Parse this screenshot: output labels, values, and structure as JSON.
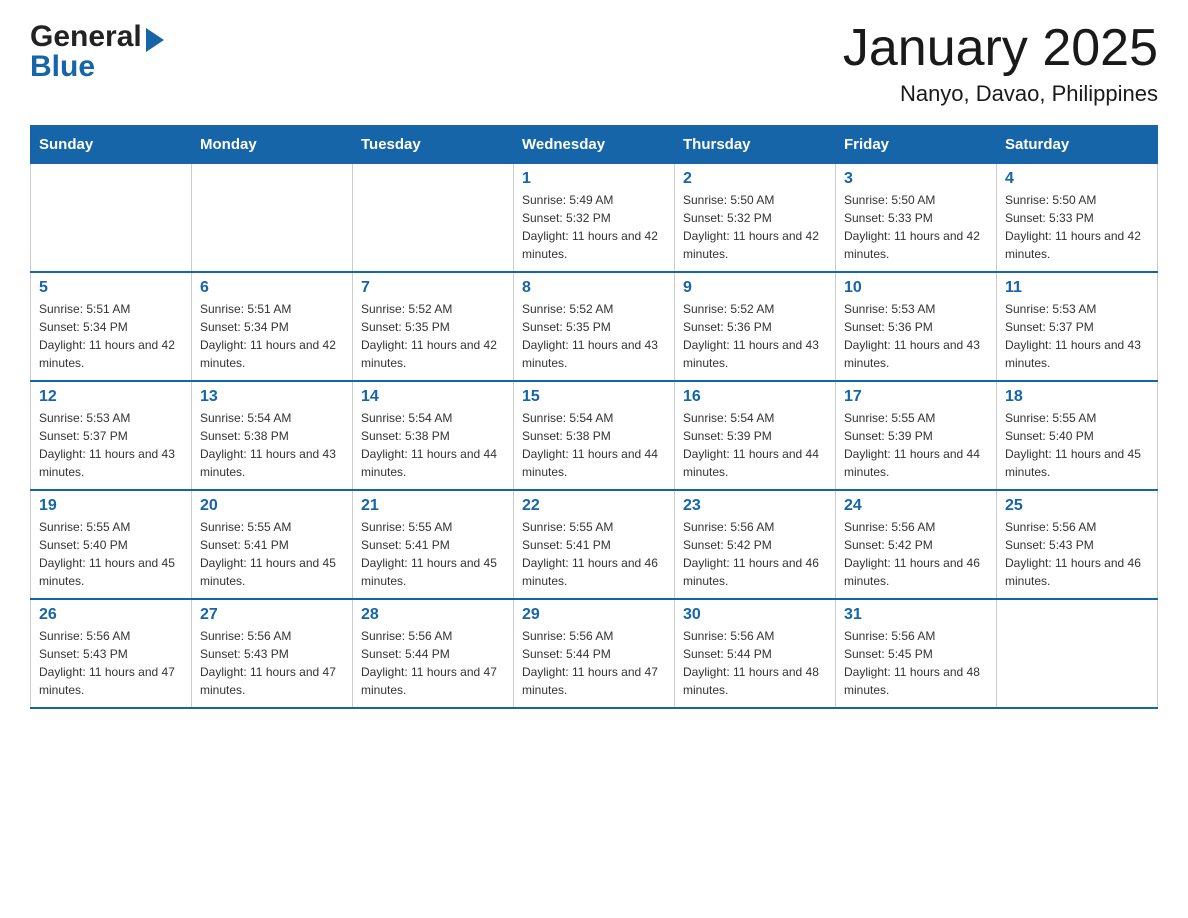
{
  "logo": {
    "general": "General",
    "blue": "Blue",
    "arrow": "▶"
  },
  "title": "January 2025",
  "subtitle": "Nanyo, Davao, Philippines",
  "days_of_week": [
    "Sunday",
    "Monday",
    "Tuesday",
    "Wednesday",
    "Thursday",
    "Friday",
    "Saturday"
  ],
  "weeks": [
    [
      {
        "day": "",
        "info": ""
      },
      {
        "day": "",
        "info": ""
      },
      {
        "day": "",
        "info": ""
      },
      {
        "day": "1",
        "info": "Sunrise: 5:49 AM\nSunset: 5:32 PM\nDaylight: 11 hours and 42 minutes."
      },
      {
        "day": "2",
        "info": "Sunrise: 5:50 AM\nSunset: 5:32 PM\nDaylight: 11 hours and 42 minutes."
      },
      {
        "day": "3",
        "info": "Sunrise: 5:50 AM\nSunset: 5:33 PM\nDaylight: 11 hours and 42 minutes."
      },
      {
        "day": "4",
        "info": "Sunrise: 5:50 AM\nSunset: 5:33 PM\nDaylight: 11 hours and 42 minutes."
      }
    ],
    [
      {
        "day": "5",
        "info": "Sunrise: 5:51 AM\nSunset: 5:34 PM\nDaylight: 11 hours and 42 minutes."
      },
      {
        "day": "6",
        "info": "Sunrise: 5:51 AM\nSunset: 5:34 PM\nDaylight: 11 hours and 42 minutes."
      },
      {
        "day": "7",
        "info": "Sunrise: 5:52 AM\nSunset: 5:35 PM\nDaylight: 11 hours and 42 minutes."
      },
      {
        "day": "8",
        "info": "Sunrise: 5:52 AM\nSunset: 5:35 PM\nDaylight: 11 hours and 43 minutes."
      },
      {
        "day": "9",
        "info": "Sunrise: 5:52 AM\nSunset: 5:36 PM\nDaylight: 11 hours and 43 minutes."
      },
      {
        "day": "10",
        "info": "Sunrise: 5:53 AM\nSunset: 5:36 PM\nDaylight: 11 hours and 43 minutes."
      },
      {
        "day": "11",
        "info": "Sunrise: 5:53 AM\nSunset: 5:37 PM\nDaylight: 11 hours and 43 minutes."
      }
    ],
    [
      {
        "day": "12",
        "info": "Sunrise: 5:53 AM\nSunset: 5:37 PM\nDaylight: 11 hours and 43 minutes."
      },
      {
        "day": "13",
        "info": "Sunrise: 5:54 AM\nSunset: 5:38 PM\nDaylight: 11 hours and 43 minutes."
      },
      {
        "day": "14",
        "info": "Sunrise: 5:54 AM\nSunset: 5:38 PM\nDaylight: 11 hours and 44 minutes."
      },
      {
        "day": "15",
        "info": "Sunrise: 5:54 AM\nSunset: 5:38 PM\nDaylight: 11 hours and 44 minutes."
      },
      {
        "day": "16",
        "info": "Sunrise: 5:54 AM\nSunset: 5:39 PM\nDaylight: 11 hours and 44 minutes."
      },
      {
        "day": "17",
        "info": "Sunrise: 5:55 AM\nSunset: 5:39 PM\nDaylight: 11 hours and 44 minutes."
      },
      {
        "day": "18",
        "info": "Sunrise: 5:55 AM\nSunset: 5:40 PM\nDaylight: 11 hours and 45 minutes."
      }
    ],
    [
      {
        "day": "19",
        "info": "Sunrise: 5:55 AM\nSunset: 5:40 PM\nDaylight: 11 hours and 45 minutes."
      },
      {
        "day": "20",
        "info": "Sunrise: 5:55 AM\nSunset: 5:41 PM\nDaylight: 11 hours and 45 minutes."
      },
      {
        "day": "21",
        "info": "Sunrise: 5:55 AM\nSunset: 5:41 PM\nDaylight: 11 hours and 45 minutes."
      },
      {
        "day": "22",
        "info": "Sunrise: 5:55 AM\nSunset: 5:41 PM\nDaylight: 11 hours and 46 minutes."
      },
      {
        "day": "23",
        "info": "Sunrise: 5:56 AM\nSunset: 5:42 PM\nDaylight: 11 hours and 46 minutes."
      },
      {
        "day": "24",
        "info": "Sunrise: 5:56 AM\nSunset: 5:42 PM\nDaylight: 11 hours and 46 minutes."
      },
      {
        "day": "25",
        "info": "Sunrise: 5:56 AM\nSunset: 5:43 PM\nDaylight: 11 hours and 46 minutes."
      }
    ],
    [
      {
        "day": "26",
        "info": "Sunrise: 5:56 AM\nSunset: 5:43 PM\nDaylight: 11 hours and 47 minutes."
      },
      {
        "day": "27",
        "info": "Sunrise: 5:56 AM\nSunset: 5:43 PM\nDaylight: 11 hours and 47 minutes."
      },
      {
        "day": "28",
        "info": "Sunrise: 5:56 AM\nSunset: 5:44 PM\nDaylight: 11 hours and 47 minutes."
      },
      {
        "day": "29",
        "info": "Sunrise: 5:56 AM\nSunset: 5:44 PM\nDaylight: 11 hours and 47 minutes."
      },
      {
        "day": "30",
        "info": "Sunrise: 5:56 AM\nSunset: 5:44 PM\nDaylight: 11 hours and 48 minutes."
      },
      {
        "day": "31",
        "info": "Sunrise: 5:56 AM\nSunset: 5:45 PM\nDaylight: 11 hours and 48 minutes."
      },
      {
        "day": "",
        "info": ""
      }
    ]
  ],
  "accent_color": "#1565a8"
}
